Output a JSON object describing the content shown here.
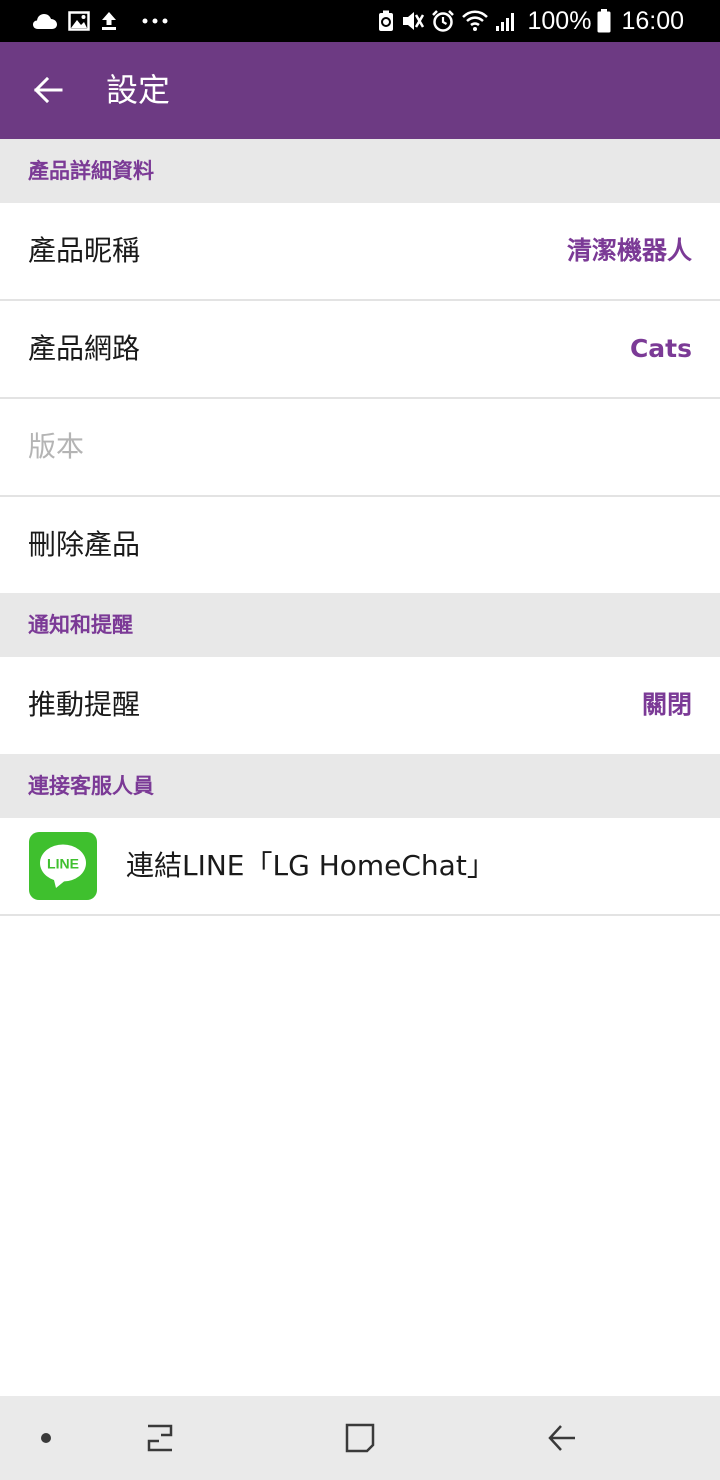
{
  "status_bar": {
    "battery": "100%",
    "time": "16:00",
    "icons": [
      "cloud-icon",
      "image-icon",
      "upload-icon",
      "more-icon",
      "recycle-icon",
      "mute-icon",
      "alarm-icon",
      "wifi-icon",
      "signal-icon",
      "battery-icon"
    ]
  },
  "header": {
    "title": "設定",
    "back_icon": "back-arrow-icon"
  },
  "sections": {
    "product": {
      "title": "產品詳細資料",
      "nickname_label": "產品昵稱",
      "nickname_value": "清潔機器人",
      "network_label": "產品網路",
      "network_value": "Cats",
      "version_label": "版本",
      "delete_label": "刪除產品"
    },
    "notifications": {
      "title": "通知和提醒",
      "push_label": "推動提醒",
      "push_value": "關閉"
    },
    "support": {
      "title": "連接客服人員",
      "line_icon_text": "LINE",
      "line_label": "連結LINE「LG HomeChat」"
    }
  },
  "nav_bar": {
    "icons": [
      "dot-icon",
      "recent-apps-icon",
      "home-icon",
      "back-icon"
    ]
  },
  "colors": {
    "app_bar": "#6d3a83",
    "accent": "#7b3a96",
    "section_bg": "#e8e8e8",
    "line_green": "#3fc02e"
  }
}
